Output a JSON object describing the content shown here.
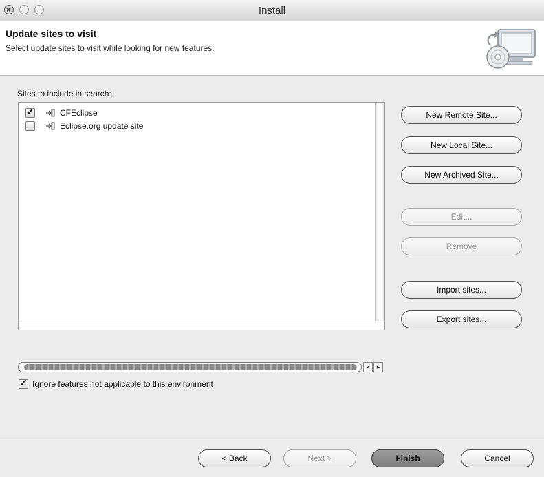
{
  "window": {
    "title": "Install"
  },
  "header": {
    "title": "Update sites to visit",
    "description": "Select update sites to visit while looking for new features."
  },
  "sites": {
    "label": "Sites to include in search:",
    "items": [
      {
        "label": "CFEclipse",
        "checked": true
      },
      {
        "label": "Eclipse.org update site",
        "checked": false
      }
    ]
  },
  "side_buttons": {
    "new_remote": "New Remote Site...",
    "new_local": "New Local Site...",
    "new_archived": "New Archived Site...",
    "edit": "Edit...",
    "remove": "Remove",
    "import": "Import sites...",
    "export": "Export sites..."
  },
  "options": {
    "ignore_label": "Ignore features not applicable to this environment",
    "ignore_checked": true
  },
  "footer": {
    "back": "< Back",
    "next": "Next >",
    "finish": "Finish",
    "cancel": "Cancel"
  },
  "icons": {
    "site": "update-site-icon",
    "header": "install-wizard-icon",
    "scroll_left": "◂",
    "scroll_right": "▸"
  }
}
